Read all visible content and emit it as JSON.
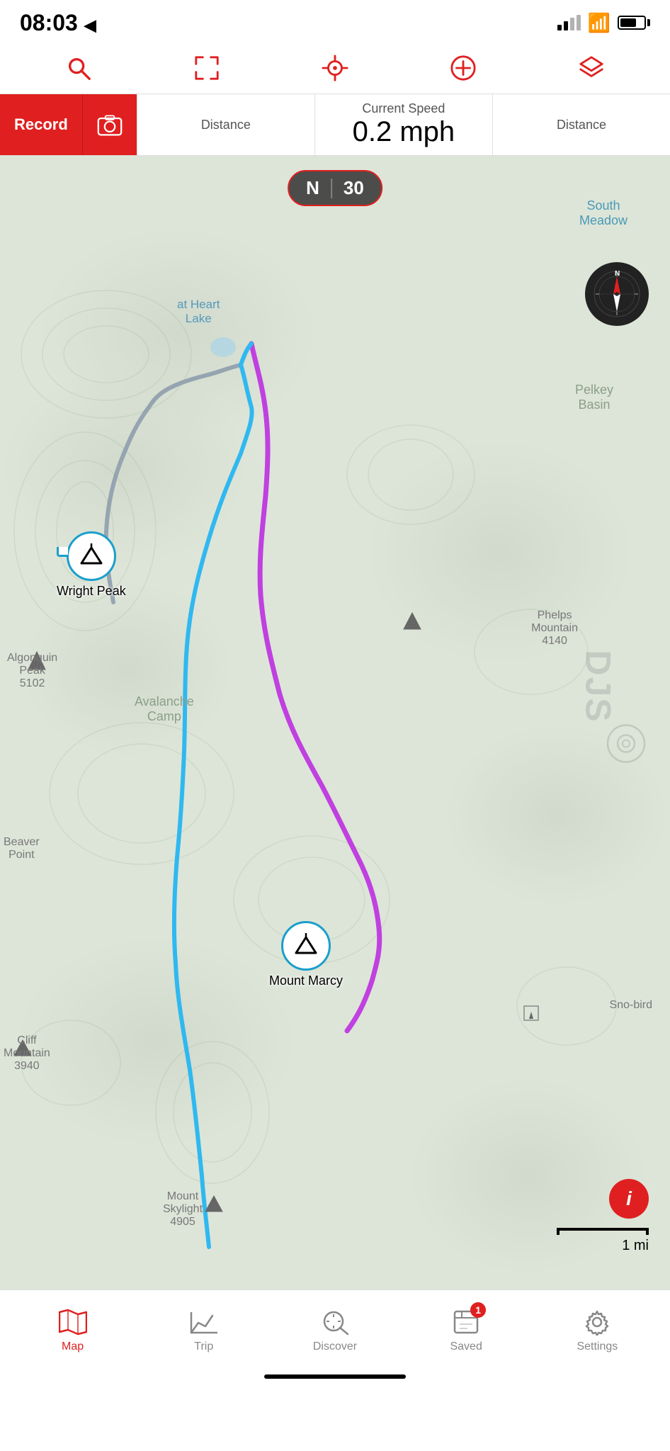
{
  "status": {
    "time": "08:03",
    "location_arrow": "▶",
    "battery_percent": 70
  },
  "toolbar": {
    "search_label": "search",
    "expand_label": "expand",
    "locate_label": "locate",
    "add_label": "add",
    "layers_label": "layers"
  },
  "action_bar": {
    "record_label": "Record",
    "camera_label": "camera"
  },
  "stats": {
    "left": {
      "label": "Distance",
      "value": ""
    },
    "center": {
      "label": "Current Speed",
      "value": "0.2 mph"
    },
    "right": {
      "label": "Distance",
      "value": ""
    }
  },
  "compass": {
    "direction": "N",
    "zoom": "30"
  },
  "map": {
    "labels": [
      {
        "text": "South\nMeadow",
        "type": "blue"
      },
      {
        "text": "Pelkey\nBasin",
        "type": "normal"
      },
      {
        "text": "Algonquin\nPeak\n5102",
        "type": "small"
      },
      {
        "text": "Phelps\nMountain\n4140",
        "type": "small"
      },
      {
        "text": "Avalanche\nCamp",
        "type": "normal"
      },
      {
        "text": "Beaver\nPoint",
        "type": "small"
      },
      {
        "text": "Cliff\nMountain\n3940",
        "type": "small"
      },
      {
        "text": "Mount\nSkylight\n4905",
        "type": "small"
      },
      {
        "text": "Sno-bird",
        "type": "small"
      },
      {
        "text": "at Heart\nLake",
        "type": "blue"
      }
    ]
  },
  "markers": [
    {
      "label": "Wright Peak",
      "position": "wright"
    },
    {
      "label": "Mount Marcy",
      "position": "marcy"
    }
  ],
  "scale": {
    "label": "1 mi"
  },
  "bottom_nav": [
    {
      "label": "Map",
      "icon": "map",
      "active": true,
      "badge": null
    },
    {
      "label": "Trip",
      "icon": "trip",
      "active": false,
      "badge": null
    },
    {
      "label": "Discover",
      "icon": "discover",
      "active": false,
      "badge": null
    },
    {
      "label": "Saved",
      "icon": "saved",
      "active": false,
      "badge": 1
    },
    {
      "label": "Settings",
      "icon": "settings",
      "active": false,
      "badge": null
    }
  ]
}
